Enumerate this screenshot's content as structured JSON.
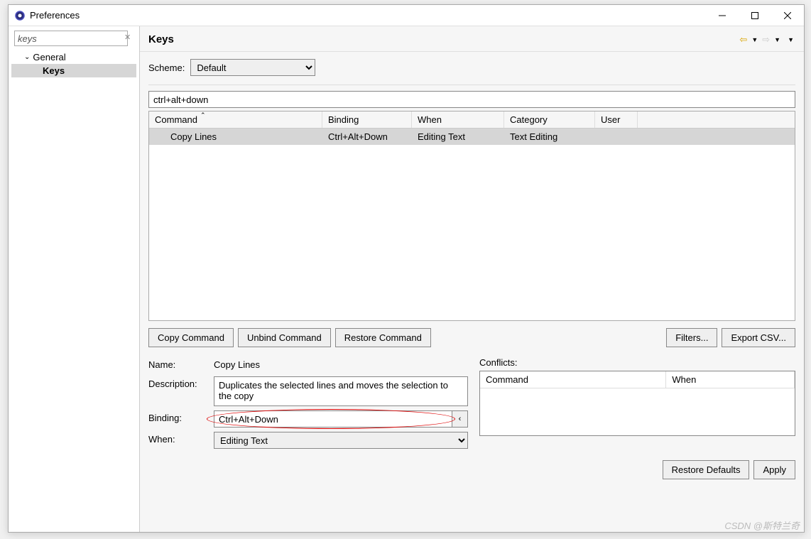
{
  "window": {
    "title": "Preferences"
  },
  "sidebar": {
    "filter_value": "keys",
    "items": [
      {
        "label": "General",
        "level": 1,
        "expanded": true,
        "selected": false
      },
      {
        "label": "Keys",
        "level": 2,
        "expanded": false,
        "selected": true
      }
    ]
  },
  "page": {
    "title": "Keys",
    "scheme_label": "Scheme:",
    "scheme_value": "Default",
    "search_value": "ctrl+alt+down",
    "table": {
      "columns": {
        "command": "Command",
        "binding": "Binding",
        "when": "When",
        "category": "Category",
        "user": "User"
      },
      "sort_column": "command",
      "rows": [
        {
          "command": "Copy Lines",
          "binding": "Ctrl+Alt+Down",
          "when": "Editing Text",
          "category": "Text Editing",
          "user": "",
          "selected": true
        }
      ]
    },
    "buttons": {
      "copy_command": "Copy Command",
      "unbind_command": "Unbind Command",
      "restore_command": "Restore Command",
      "filters": "Filters...",
      "export_csv": "Export CSV..."
    },
    "details": {
      "name_label": "Name:",
      "name_value": "Copy Lines",
      "desc_label": "Description:",
      "desc_value": "Duplicates the selected lines and moves the selection to the copy",
      "binding_label": "Binding:",
      "binding_value": "Ctrl+Alt+Down",
      "when_label": "When:",
      "when_value": "Editing Text",
      "conflicts_label": "Conflicts:",
      "conflicts_columns": {
        "command": "Command",
        "when": "When"
      }
    },
    "footer": {
      "restore_defaults": "Restore Defaults",
      "apply": "Apply"
    }
  },
  "watermark": "CSDN @斯特兰奇"
}
